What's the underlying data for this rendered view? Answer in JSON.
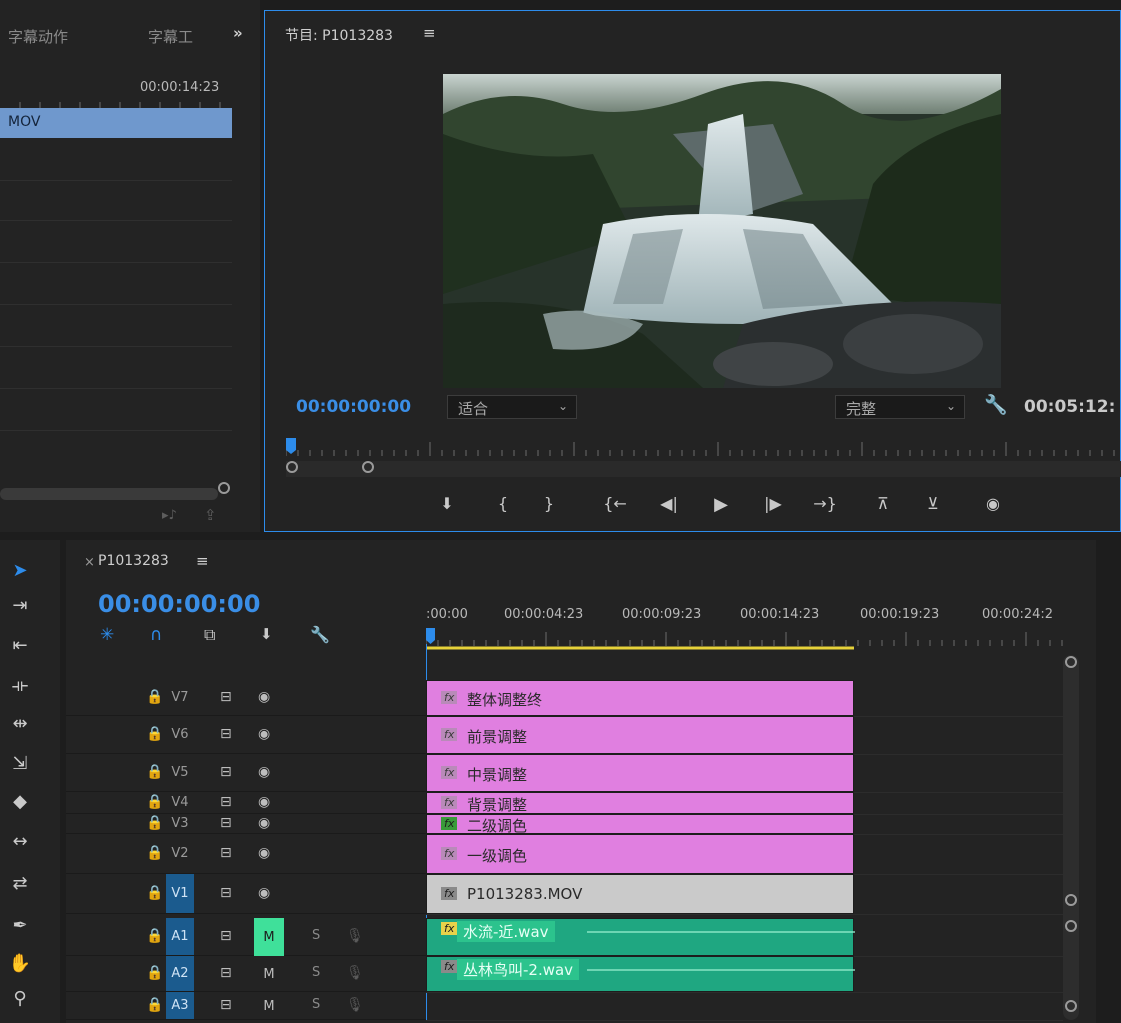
{
  "source_panel": {
    "tabs": [
      "字幕动作",
      "字幕工",
      "»"
    ],
    "timecode": "00:00:14:23",
    "clip_label": "MOV"
  },
  "program_monitor": {
    "title": "节目: P1013283",
    "menu_icon": "≡",
    "current_timecode": "00:00:00:00",
    "fit_select": "适合",
    "quality_select": "完整",
    "duration_timecode": "00:05:12:",
    "transport": [
      "marker-icon",
      "mark-in-icon",
      "mark-out-icon",
      "go-to-in-icon",
      "step-back-icon",
      "play-icon",
      "step-forward-icon",
      "go-to-out-icon",
      "lift-icon",
      "extract-icon",
      "export-frame-icon"
    ]
  },
  "timeline": {
    "sequence_name": "P1013283",
    "current_timecode": "00:00:00:00",
    "ruler_labels": [
      ":00:00",
      "00:00:04:23",
      "00:00:09:23",
      "00:00:14:23",
      "00:00:19:23",
      "00:00:24:2"
    ],
    "video_tracks": [
      {
        "name": "V7",
        "clip": "整体调整终",
        "type": "adjustment"
      },
      {
        "name": "V6",
        "clip": "前景调整",
        "type": "adjustment"
      },
      {
        "name": "V5",
        "clip": "中景调整",
        "type": "adjustment"
      },
      {
        "name": "V4",
        "clip": "背景调整",
        "type": "adjustment"
      },
      {
        "name": "V3",
        "clip": "二级调色",
        "type": "adjustment"
      },
      {
        "name": "V2",
        "clip": "一级调色",
        "type": "adjustment"
      },
      {
        "name": "V1",
        "clip": "P1013283.MOV",
        "type": "video"
      }
    ],
    "audio_tracks": [
      {
        "name": "A1",
        "clip": "水流-近.wav",
        "m": "M",
        "s": "S"
      },
      {
        "name": "A2",
        "clip": "丛林鸟叫-2.wav",
        "m": "M",
        "s": "S"
      },
      {
        "name": "A3",
        "clip": "",
        "m": "M",
        "s": "S"
      }
    ],
    "fx_label": "fx"
  },
  "colors": {
    "accent_blue": "#2d8ceb",
    "adjustment_clip": "#e07fe0",
    "audio_clip": "#1fa781",
    "source_clip": "#6f98cd"
  }
}
